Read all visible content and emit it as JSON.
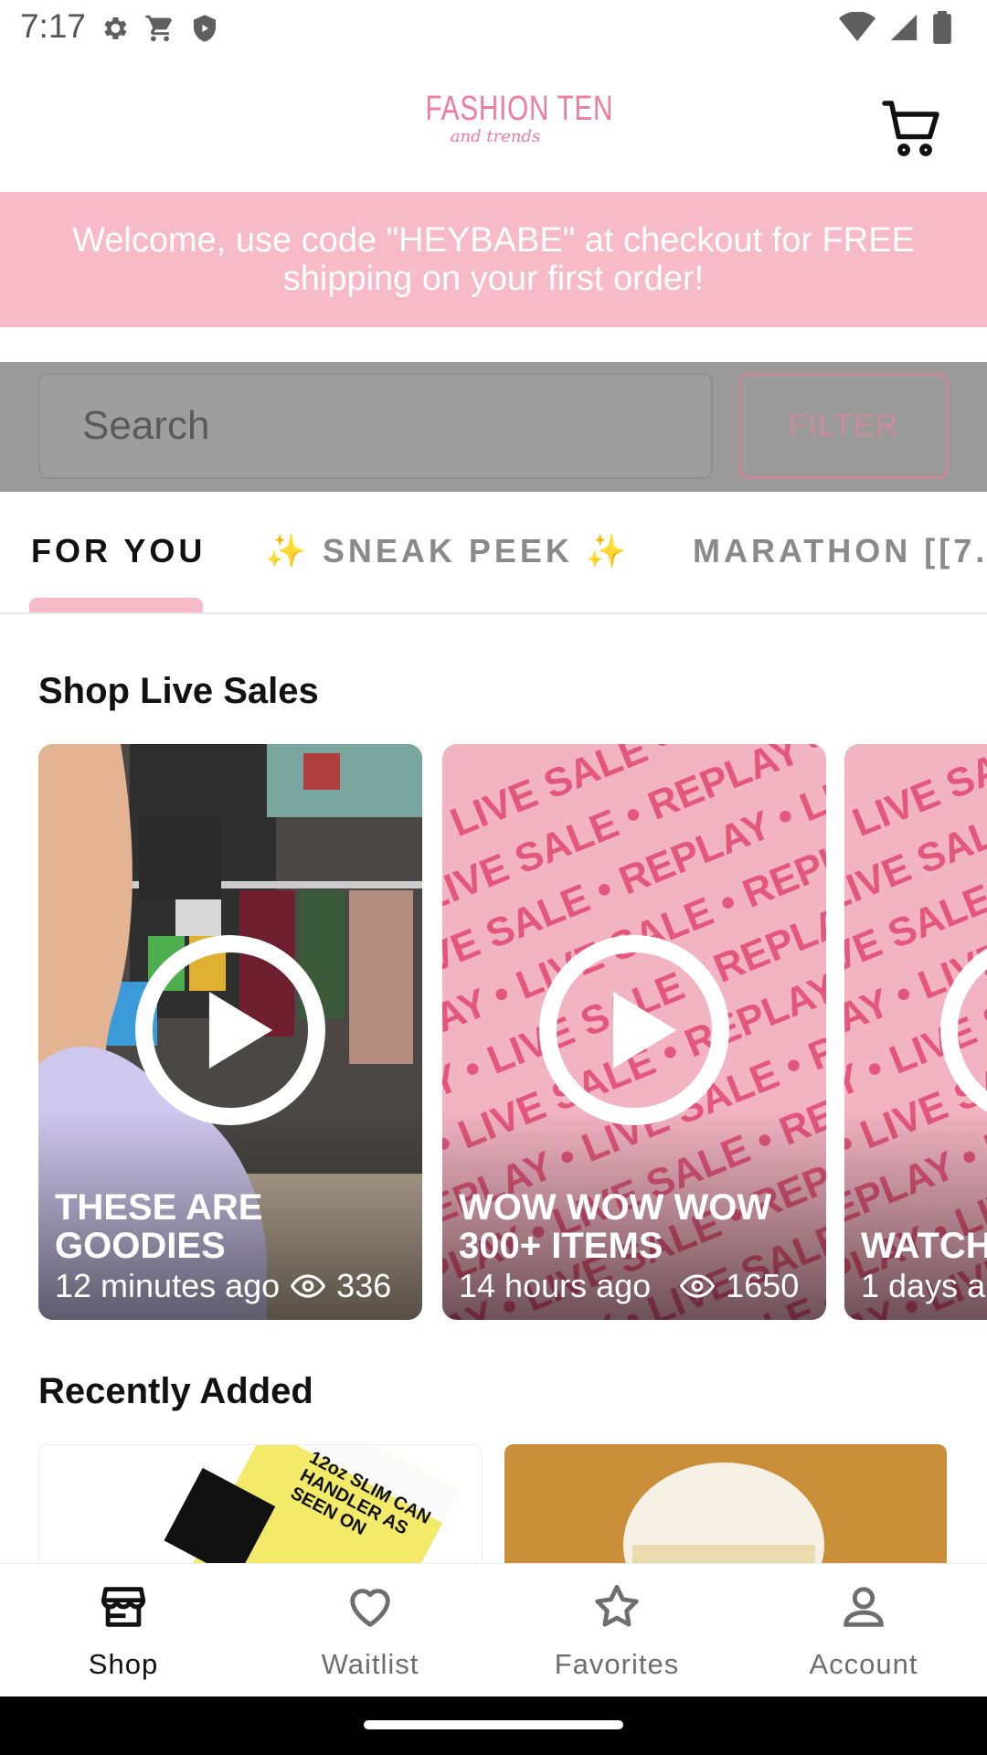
{
  "status_bar": {
    "time": "7:17",
    "icons_left": [
      "gear-icon",
      "cart-icon",
      "shield-icon"
    ],
    "icons_right": [
      "wifi-icon",
      "signal-icon",
      "battery-icon"
    ]
  },
  "header": {
    "logo_main": "FASHION TEN",
    "logo_sub": "and trends",
    "cart_icon": "cart-icon",
    "brand_color": "#f07aa0"
  },
  "promo": {
    "text": "Welcome, use code \"HEYBABE\" at checkout for FREE shipping on your first order!",
    "background": "#f7bac8"
  },
  "search": {
    "placeholder": "Search",
    "filter_label": "FILTER"
  },
  "tabs": [
    {
      "label": "FOR YOU",
      "active": true
    },
    {
      "label": "✨ SNEAK  PEEK ✨",
      "active": false
    },
    {
      "label": "MARATHON [[7.",
      "active": false
    }
  ],
  "live_sales": {
    "title": "Shop Live Sales",
    "cards": [
      {
        "title": "THESE ARE GOODIES",
        "time": "12 minutes ago",
        "views": "336"
      },
      {
        "title": "WOW WOW WOW 300+ ITEMS",
        "time": "14 hours ago",
        "views": "1650"
      },
      {
        "title": "WATCH",
        "time": "1 days a",
        "views": ""
      }
    ],
    "replay_pattern": "REPLAY • LIVE SALE • REPLAY • LIVE SALE •"
  },
  "recently_added": {
    "title": "Recently Added",
    "items": [
      {
        "image_text": "12oz SLIM CAN HANDLER AS SEEN ON"
      },
      {
        "image_text": ""
      }
    ]
  },
  "bottom_nav": [
    {
      "label": "Shop",
      "icon": "storefront-icon",
      "active": true
    },
    {
      "label": "Waitlist",
      "icon": "heart-icon",
      "active": false
    },
    {
      "label": "Favorites",
      "icon": "star-icon",
      "active": false
    },
    {
      "label": "Account",
      "icon": "person-icon",
      "active": false
    }
  ]
}
